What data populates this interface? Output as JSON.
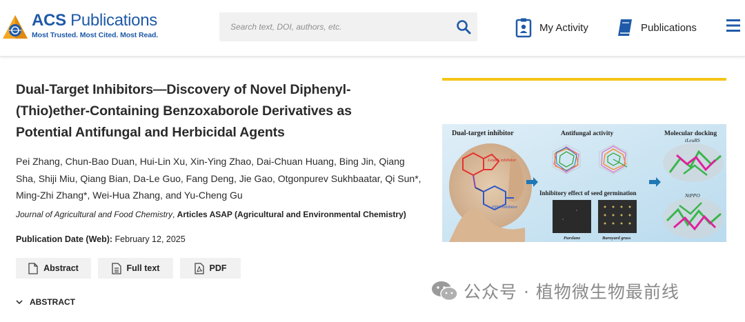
{
  "header": {
    "brand": {
      "name_bold": "ACS",
      "name_rest": "Publications",
      "tagline": "Most Trusted. Most Cited. Most Read."
    },
    "search": {
      "placeholder": "Search text, DOI, authors, etc."
    },
    "nav": {
      "activity_label": "My Activity",
      "publications_label": "Publications"
    }
  },
  "article": {
    "title": "Dual-Target Inhibitors—Discovery of Novel Diphenyl-(Thio)ether-Containing Benzoxaborole Derivatives as Potential Antifungal and Herbicidal Agents",
    "authors": "Pei Zhang, Chun-Bao Duan, Hui-Lin Xu, Xin-Ying Zhao, Dai-Chuan Huang, Bing Jin, Qiang Sha, Shiji Miu, Qiang Bian, Da-Le Guo, Fang Deng, Jie Gao, Otgonpurev Sukhbaatar, Qi Sun*, Ming-Zhi Zhang*, Wei-Hua Zhang, and Yu-Cheng Gu",
    "journal": "Journal of Agricultural and Food Chemistry",
    "section": "Articles ASAP (Agricultural and Environmental Chemistry)",
    "pubdate_label": "Publication Date (Web):",
    "pubdate_value": "February 12, 2025",
    "buttons": {
      "abstract": "Abstract",
      "fulltext": "Full text",
      "pdf": "PDF"
    },
    "abstract_heading": "ABSTRACT"
  },
  "toc_graphic": {
    "panel1_title": "Dual-target inhibitor",
    "label_leurs": "LeuRS inhibitor",
    "label_ppo": "PPO inhibitor",
    "panel2_title": "Antifungal activity",
    "panel3_title": "Inhibitory effect of seed germination",
    "caption_purslane": "Purslane",
    "caption_barnyard": "Barnyard grass",
    "panel4_title": "Molecular docking",
    "dock1_label": "tLeuRS",
    "dock2_label": "NtPPO"
  },
  "watermark": {
    "text": "公众号 · 植物微生物最前线"
  },
  "colors": {
    "brand_blue": "#1f5aa8",
    "accent_yellow": "#f5c518",
    "button_bg": "#f1f1f1"
  }
}
